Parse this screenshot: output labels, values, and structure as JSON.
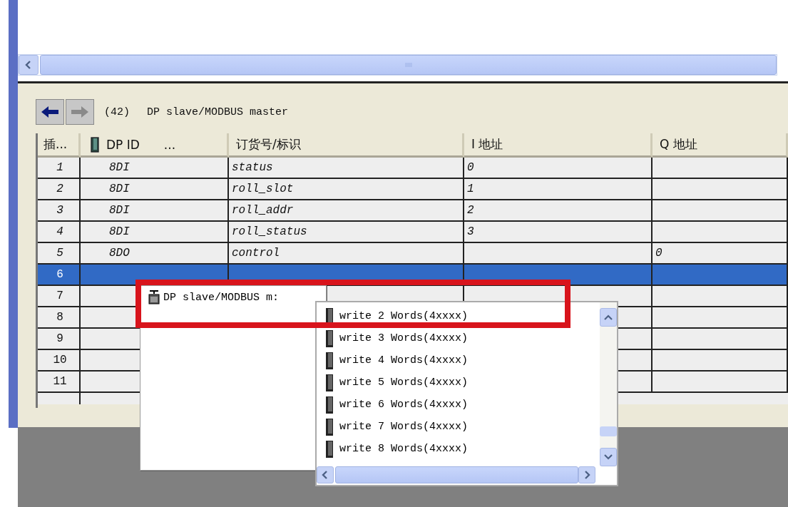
{
  "header": {
    "count": "(42)",
    "title": "DP slave/MODBUS master"
  },
  "table": {
    "columns": [
      {
        "label": "插..."
      },
      {
        "label": "DP ID",
        "suffix": "...",
        "icon": true
      },
      {
        "label": "订货号/标识"
      },
      {
        "label": "I 地址"
      },
      {
        "label": "Q 地址"
      }
    ],
    "rows": [
      {
        "slot": "1",
        "dp_id": "8DI",
        "order_id": "status",
        "i_address": "0",
        "selected": false,
        "filled": true
      },
      {
        "slot": "2",
        "dp_id": "8DI",
        "order_id": "roll_slot",
        "i_address": "1",
        "selected": false,
        "filled": true
      },
      {
        "slot": "3",
        "dp_id": "8DI",
        "order_id": "roll_addr",
        "i_address": "2",
        "selected": false,
        "filled": true
      },
      {
        "slot": "4",
        "dp_id": "8DI",
        "order_id": "roll_status",
        "i_address": "3",
        "selected": false,
        "filled": true
      },
      {
        "slot": "5",
        "dp_id": "8DO",
        "order_id": "control",
        "q_address": "0",
        "selected": false,
        "filled": true
      },
      {
        "slot": "6",
        "selected": true,
        "filled": false
      },
      {
        "slot": "7",
        "selected": false,
        "filled": false
      },
      {
        "slot": "8",
        "selected": false,
        "filled": false
      },
      {
        "slot": "9",
        "selected": false,
        "filled": false
      },
      {
        "slot": "10",
        "selected": false,
        "filled": false
      },
      {
        "slot": "11",
        "selected": false,
        "filled": false
      }
    ]
  },
  "popup": {
    "module": "DP slave/MODBUS m:",
    "items": [
      "write 2 Words(4xxxx)",
      "write 3 Words(4xxxx)",
      "write 4 Words(4xxxx)",
      "write 5 Words(4xxxx)",
      "write 6 Words(4xxxx)",
      "write 7 Words(4xxxx)",
      "write 8 Words(4xxxx)"
    ]
  }
}
